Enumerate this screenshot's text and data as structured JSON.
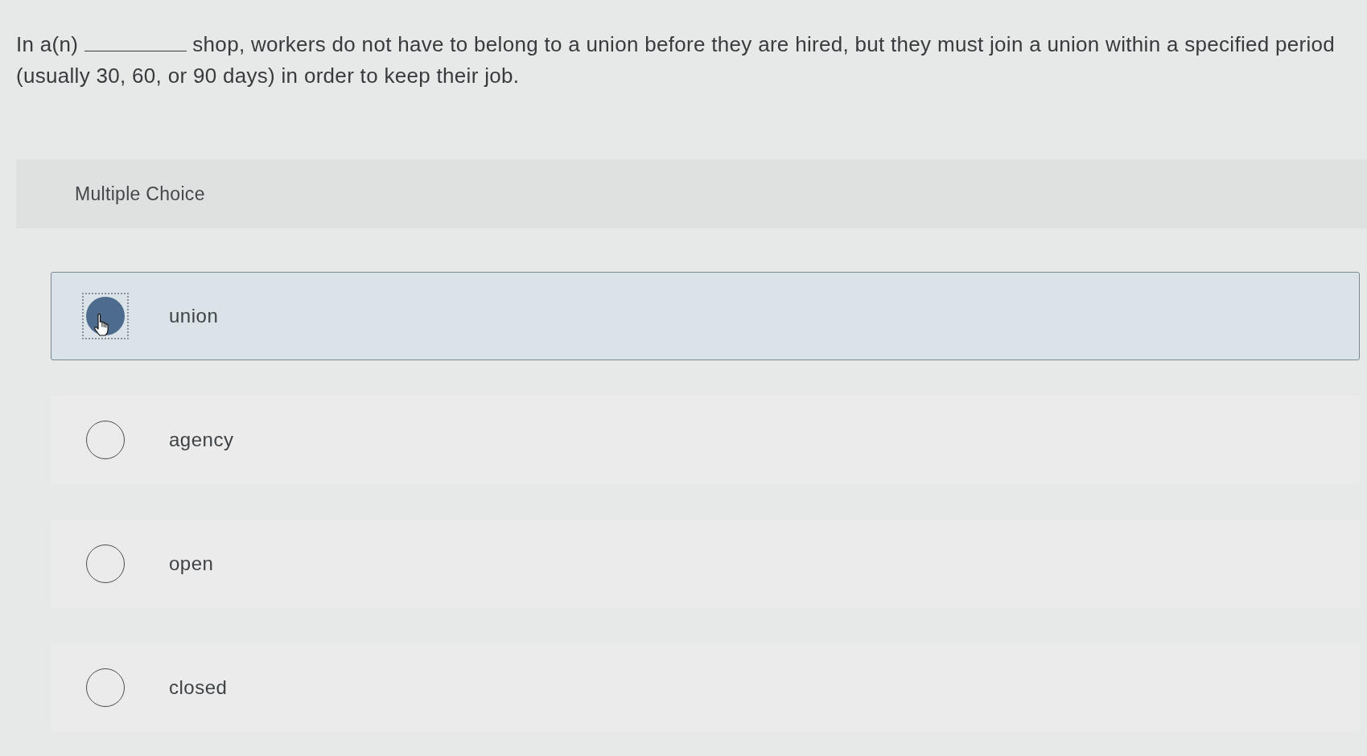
{
  "question": {
    "before_blank": "In a(n)",
    "after_blank": "shop, workers do not have to belong to a union before they are hired, but they must join a union within a specified period",
    "continuation": "(usually 30, 60, or 90 days) in order to keep their job."
  },
  "section_label": "Multiple Choice",
  "options": [
    {
      "label": "union",
      "selected": true,
      "focused": true,
      "hovered": true
    },
    {
      "label": "agency",
      "selected": false,
      "focused": false,
      "hovered": false
    },
    {
      "label": "open",
      "selected": false,
      "focused": false,
      "hovered": false
    },
    {
      "label": "closed",
      "selected": false,
      "focused": false,
      "hovered": false
    }
  ]
}
